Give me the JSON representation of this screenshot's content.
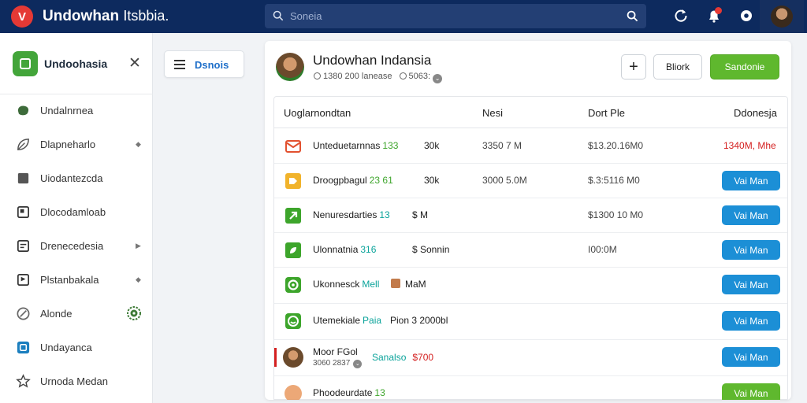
{
  "topbar": {
    "logo_letter": "V",
    "title": "Undowhan",
    "title_sub": "Itsbbia.",
    "search_placeholder": "Soneia"
  },
  "sidebar": {
    "brand": "Undoohasia",
    "items": [
      {
        "label": "Undalnrnea",
        "icon": "blob-icon",
        "chevron": false
      },
      {
        "label": "Dlapneharlo",
        "icon": "leaf-icon",
        "chevron": true
      },
      {
        "label": "Uiodantezcda",
        "icon": "folder-icon",
        "chevron": false
      },
      {
        "label": "Dlocodamloab",
        "icon": "card-icon",
        "chevron": false
      },
      {
        "label": "Drenecedesia",
        "icon": "window-icon",
        "chevron": true
      },
      {
        "label": "Plstanbakala",
        "icon": "flag-icon",
        "chevron": true
      },
      {
        "label": "Alonde",
        "icon": "compass-icon",
        "chevron": false
      },
      {
        "label": "Undayanca",
        "icon": "square-icon",
        "chevron": false
      },
      {
        "label": "Urnoda Medan",
        "icon": "star-icon",
        "chevron": false
      }
    ]
  },
  "side_button": {
    "label": "Dsnois"
  },
  "card": {
    "title": "Undowhan Indansia",
    "meta_1": "1380 200 lanease",
    "meta_2": "5063:",
    "buttons": {
      "plus": "+",
      "outline": "Bliork",
      "green": "Sandonie"
    },
    "table": {
      "headers": [
        "Uoglarnondtan",
        "Nesi",
        "Dort Ple",
        "Ddonesja"
      ],
      "rows": [
        {
          "name": "Unteduetarnnas",
          "tag": "133",
          "tag_color": "green",
          "col2": "30k",
          "col3": "3350 7 M",
          "col4": "$13.20.16M0",
          "right": "1340M, Mhe",
          "right_type": "red",
          "icon": "mail-icon",
          "icon_color": "#e2512f"
        },
        {
          "name": "Droogpbagul",
          "tag": "23 61",
          "tag_color": "green",
          "col2": "30k",
          "col3": "3000 5.0M",
          "col4": "$.3:5116 M0",
          "right": "Vai Man",
          "right_type": "button",
          "icon": "tag-icon",
          "icon_color": "#f1b32b"
        },
        {
          "name": "Nenuresdarties",
          "tag": "13",
          "tag_color": "teal",
          "col2": "$ M",
          "col3": "",
          "col4": "$1300 10 M0",
          "right": "Vai Man",
          "right_type": "button",
          "icon": "arrow-icon",
          "icon_color": "#3da52b"
        },
        {
          "name": "Ulonnatnia",
          "tag": "316",
          "tag_color": "teal",
          "col2": "$ Sonnin",
          "col3": "",
          "col4": "I00:0M",
          "right": "Vai Man",
          "right_type": "button",
          "icon": "leaf-icon",
          "icon_color": "#3da52b"
        },
        {
          "name": "Ukonnesck",
          "tag": "Mell",
          "tag_color": "teal",
          "col2": "MaM",
          "col3": "",
          "col4": "",
          "right": "Vai Man",
          "right_type": "button",
          "icon": "circle-icon",
          "icon_color": "#3da52b"
        },
        {
          "name": "Utemekiale",
          "tag": "Paia",
          "tag_color": "teal",
          "col2": "Pion 3 2000bl",
          "col3": "",
          "col4": "",
          "right": "Vai Man",
          "right_type": "button",
          "icon": "face-icon",
          "icon_color": "#3da52b"
        },
        {
          "name": "Moor FGol",
          "sub": "3060 2837",
          "tag": "Sanalso",
          "tag_color": "teal",
          "col2": "$700",
          "col2_color": "red",
          "col3": "",
          "col4": "",
          "right": "Vai Man",
          "right_type": "button",
          "icon": "avatar-icon",
          "icon_color": "#7a5230"
        },
        {
          "name": "Phoodeurdate",
          "tag": "13",
          "tag_color": "green",
          "col2": "",
          "col3": "",
          "col4": "",
          "right": "Vai Man",
          "right_type": "green-button",
          "icon": "fruit-icon",
          "icon_color": "#e58b4a"
        }
      ]
    }
  },
  "colors": {
    "topbar": "#0d2a5e",
    "accent_green": "#5fb82e",
    "accent_blue": "#1c8fd6",
    "alert_red": "#d42020"
  }
}
